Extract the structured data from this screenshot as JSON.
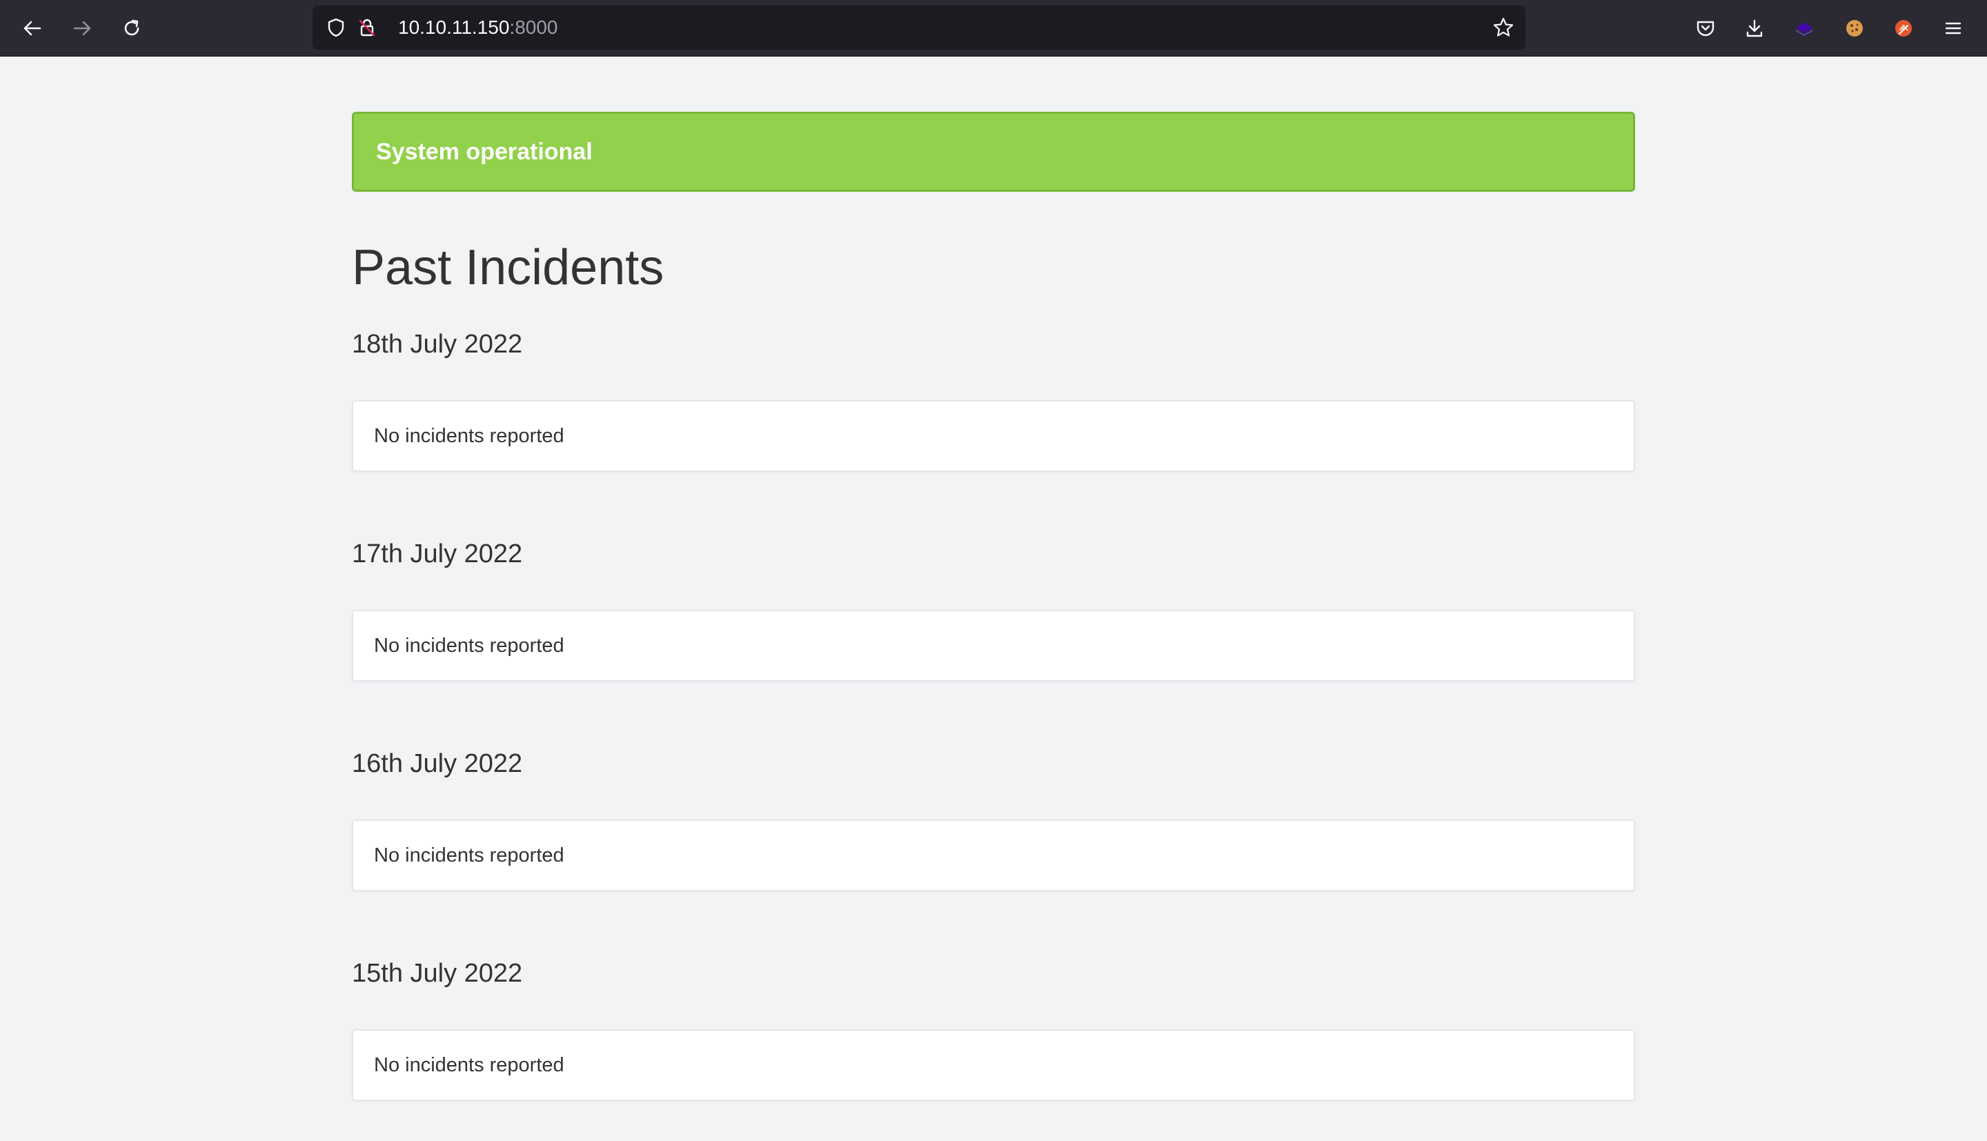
{
  "browser": {
    "url_host": "10.10.11.150",
    "url_port": ":8000"
  },
  "status": {
    "text": "System operational",
    "color": "#92d14b"
  },
  "incidents": {
    "title": "Past Incidents",
    "days": [
      {
        "date": "18th July 2022",
        "message": "No incidents reported"
      },
      {
        "date": "17th July 2022",
        "message": "No incidents reported"
      },
      {
        "date": "16th July 2022",
        "message": "No incidents reported"
      },
      {
        "date": "15th July 2022",
        "message": "No incidents reported"
      }
    ]
  }
}
